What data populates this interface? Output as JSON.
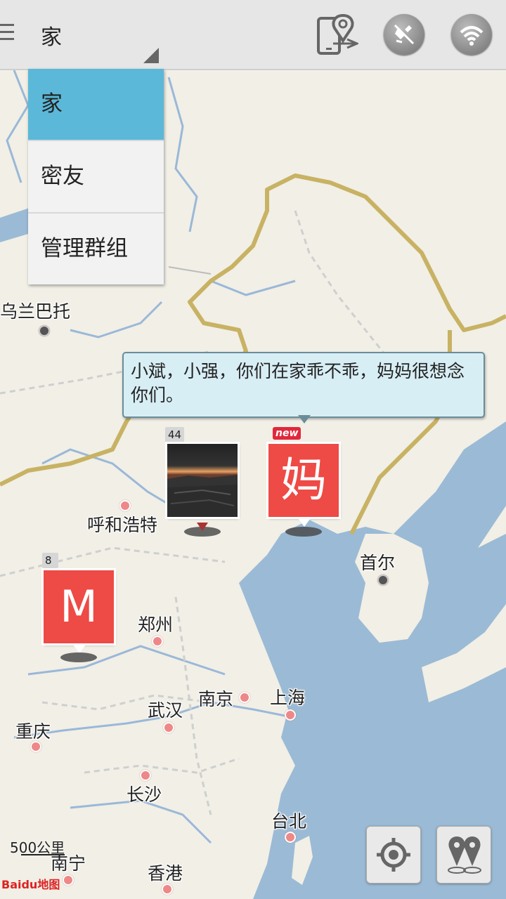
{
  "topbar": {
    "selected_group": "家"
  },
  "dropdown": {
    "items": [
      "家",
      "密友",
      "管理群组"
    ]
  },
  "bubble": {
    "message": "小斌，小强，你们在家乖不乖，妈妈很想念你们。"
  },
  "markers": [
    {
      "time": "44分以前",
      "type": "photo"
    },
    {
      "time": "",
      "label": "妈",
      "badge": "new"
    },
    {
      "time": "8分以前",
      "label": "M"
    }
  ],
  "cities": [
    "乌兰巴托",
    "呼和浩特",
    "首尔",
    "郑州",
    "南京",
    "上海",
    "武汉",
    "重庆",
    "长沙",
    "台北",
    "南宁",
    "香港"
  ],
  "map": {
    "scale": "500公里",
    "logo": "Baidu地图",
    "colors": {
      "land": "#f1efe6",
      "sea": "#9bbad5",
      "border": "#c8b263",
      "river": "#9ab8d8"
    }
  },
  "icons": {
    "menu": "menu-icon",
    "phone_location": "phone-location-icon",
    "gps": "gps-off-icon",
    "wifi": "wifi-icon",
    "locate": "locate-icon",
    "pins": "pins-icon"
  }
}
